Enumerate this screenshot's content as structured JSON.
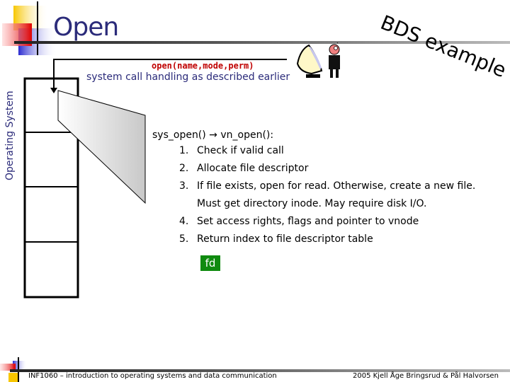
{
  "slide": {
    "title": "Open",
    "sidebar_label": "Operating System",
    "badge": "BDS example",
    "call_signature": "open(name,mode,perm)",
    "call_description": "system call handling as described earlier",
    "sys_open_line": "sys_open() → vn_open():",
    "steps": [
      {
        "num": "1.",
        "text": "Check if valid call"
      },
      {
        "num": "2.",
        "text": "Allocate file descriptor"
      },
      {
        "num": "3.",
        "text": "If file exists, open for read. Otherwise, create a new file."
      },
      {
        "num": "",
        "text": "Must get directory inode. May require disk I/O."
      },
      {
        "num": "4.",
        "text": "Set access rights, flags and pointer to vnode"
      },
      {
        "num": "5.",
        "text": "Return index to file descriptor table"
      }
    ],
    "result_label": "fd",
    "result_color": "#0f8a0f",
    "title_color": "#2b2b7a",
    "signature_color": "#c00000"
  },
  "footer": {
    "left": "INF1060 – introduction to operating systems and data communication",
    "right": "2005  Kjell Åge Bringsrud & Pål Halvorsen"
  }
}
